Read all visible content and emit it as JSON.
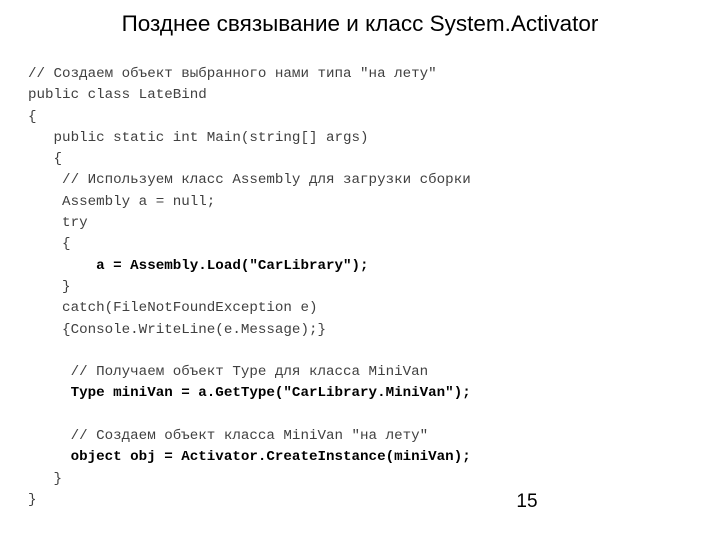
{
  "slide": {
    "title": "Позднее связывание и класс System.Activator",
    "page_number": "15",
    "background_color": "#ffffff",
    "title_color": "#000000",
    "code_color": "#404040",
    "code_bold_color": "#000000"
  },
  "code": {
    "language": "csharp",
    "lines": [
      {
        "text": "// Создаем объект выбранного нами типа \"на лету\"",
        "bold": false
      },
      {
        "text": "public class LateBind",
        "bold": false
      },
      {
        "text": "{",
        "bold": false
      },
      {
        "text": "   public static int Main(string[] args)",
        "bold": false
      },
      {
        "text": "   {",
        "bold": false
      },
      {
        "text": "    // Используем класс Assembly для загрузки сборки",
        "bold": false
      },
      {
        "text": "    Assembly a = null;",
        "bold": false
      },
      {
        "text": "    try",
        "bold": false
      },
      {
        "text": "    {",
        "bold": false
      },
      {
        "text": "        a = Assembly.Load(\"CarLibrary\");",
        "bold": true
      },
      {
        "text": "    }",
        "bold": false
      },
      {
        "text": "    catch(FileNotFoundException e)",
        "bold": false
      },
      {
        "text": "    {Console.WriteLine(e.Message);}",
        "bold": false
      },
      {
        "text": "",
        "bold": false
      },
      {
        "text": "     // Получаем объект Type для класса MiniVan",
        "bold": false
      },
      {
        "text": "     Type miniVan = a.GetType(\"CarLibrary.MiniVan\");",
        "bold": true
      },
      {
        "text": "",
        "bold": false
      },
      {
        "text": "     // Создаем объект класса MiniVan \"на лету\"",
        "bold": false
      },
      {
        "text": "     object obj = Activator.CreateInstance(miniVan);",
        "bold": true
      },
      {
        "text": "   }",
        "bold": false
      },
      {
        "text": "}",
        "bold": false
      }
    ]
  }
}
